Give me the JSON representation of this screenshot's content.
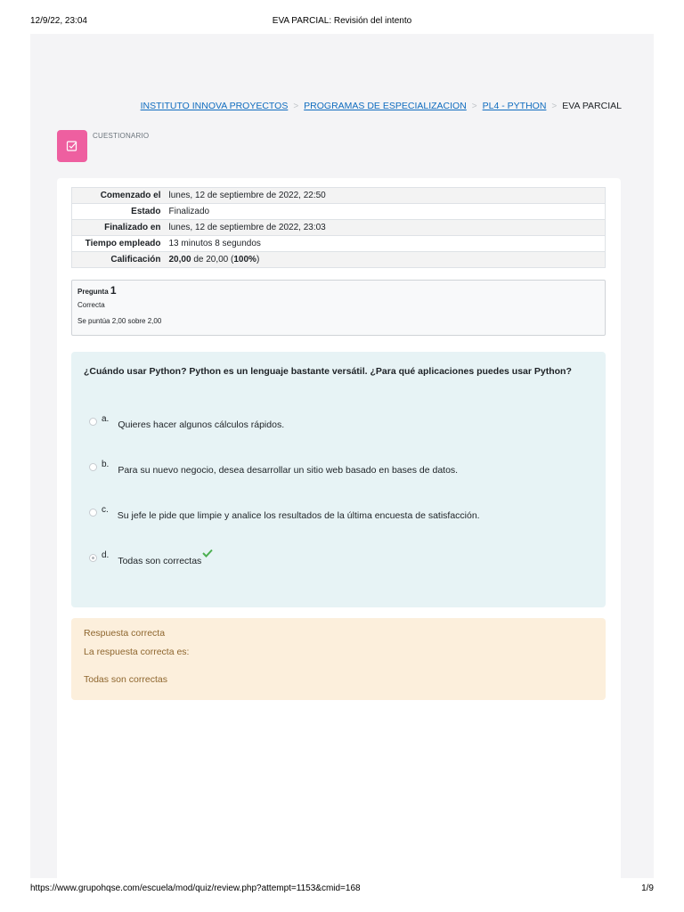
{
  "print": {
    "datetime": "12/9/22, 23:04",
    "doc_title": "EVA PARCIAL: Revisión del intento",
    "url": "https://www.grupohqse.com/escuela/mod/quiz/review.php?attempt=1153&cmid=168",
    "page_counter": "1/9"
  },
  "breadcrumb": {
    "items": [
      "INSTITUTO INNOVA PROYECTOS",
      "PROGRAMAS DE ESPECIALIZACION",
      "PL4 - PYTHON"
    ],
    "current": "EVA PARCIAL"
  },
  "activity": {
    "label": "CUESTIONARIO",
    "icon": "quiz-icon",
    "color": "#ee5fa0"
  },
  "summary": {
    "rows": [
      {
        "label": "Comenzado el",
        "value": "lunes, 12 de septiembre de 2022, 22:50"
      },
      {
        "label": "Estado",
        "value": "Finalizado"
      },
      {
        "label": "Finalizado en",
        "value": "lunes, 12 de septiembre de 2022, 23:03"
      },
      {
        "label": "Tiempo empleado",
        "value": "13 minutos 8 segundos"
      }
    ],
    "grade_label": "Calificación",
    "grade_value": "20,00",
    "grade_of": "de 20,00 (",
    "grade_percent": "100%",
    "grade_close": ")"
  },
  "question": {
    "label": "Pregunta",
    "number": "1",
    "state": "Correcta",
    "grade": "Se puntúa 2,00 sobre 2,00",
    "text": "¿Cuándo usar Python? Python es un lenguaje bastante versátil. ¿Para qué aplicaciones puedes usar Python?",
    "options": [
      {
        "letter": "a.",
        "text": "Quieres hacer algunos cálculos rápidos.",
        "selected": false
      },
      {
        "letter": "b.",
        "text": "Para su nuevo negocio, desea desarrollar un sitio web basado en bases de datos.",
        "selected": false
      },
      {
        "letter": "c.",
        "text": "Su jefe le pide que limpie y analice los resultados de la última encuesta de satisfacción.",
        "selected": false
      },
      {
        "letter": "d.",
        "text": "Todas son correctas",
        "selected": true
      }
    ],
    "correct_icon": "check-icon",
    "correct_color": "#4caf50"
  },
  "feedback": {
    "status": "Respuesta correcta",
    "intro": "La respuesta correcta es:",
    "answer": "Todas son correctas"
  }
}
